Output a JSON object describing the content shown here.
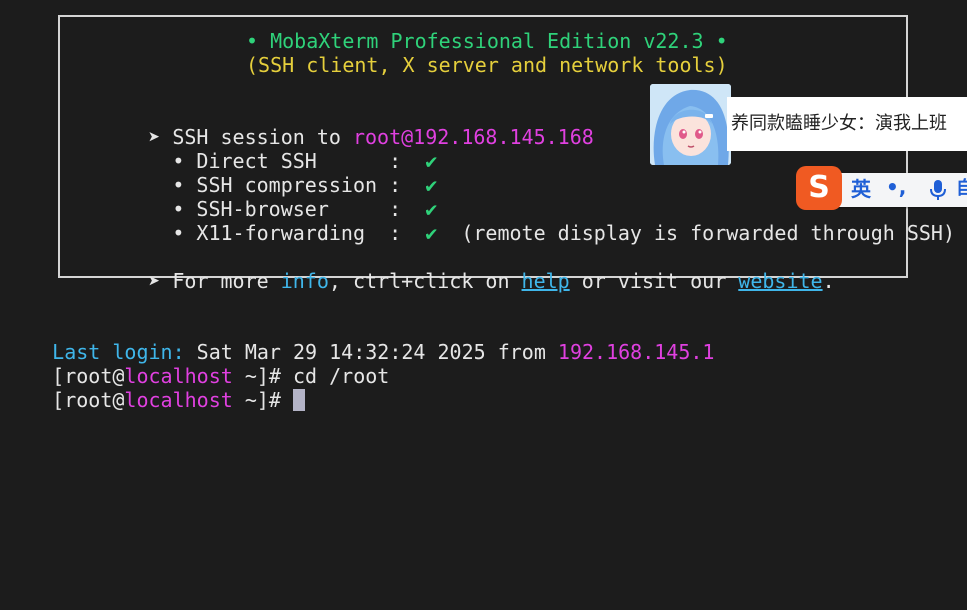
{
  "banner": {
    "title": "• MobaXterm Professional Edition v22.3 •",
    "subtitle": "(SSH client, X server and network tools)",
    "session_prefix": "➤ SSH session to ",
    "session_target": "root@192.168.145.168",
    "features": [
      {
        "label": "  • Direct SSH      :  ",
        "check": "✔",
        "note": ""
      },
      {
        "label": "  • SSH compression :  ",
        "check": "✔",
        "note": ""
      },
      {
        "label": "  • SSH-browser     :  ",
        "check": "✔",
        "note": ""
      },
      {
        "label": "  • X11-forwarding  :  ",
        "check": "✔",
        "note": "  (remote display is forwarded through SSH)"
      }
    ],
    "info_line": {
      "prefix": "➤ For more ",
      "info": "info",
      "middle1": ", ctrl+click on ",
      "help": "help",
      "middle2": " or visit our ",
      "website": "website",
      "suffix": "."
    }
  },
  "terminal": {
    "last_login_label": "Last login:",
    "last_login_value": " Sat Mar 29 14:32:24 2025 from ",
    "last_login_ip": "192.168.145.1",
    "prompt_open": "[root@",
    "prompt_host": "localhost",
    "prompt_close": " ~]# ",
    "command1": "cd /root",
    "command2": ""
  },
  "overlay": {
    "sticker_text": "养同款瞌睡少女：演我上班"
  },
  "ime": {
    "logo": "S",
    "lang": "英",
    "punct": "•,",
    "extra": "自"
  },
  "colors": {
    "background": "#1c1c1c",
    "green": "#2fd27a",
    "yellow": "#e5cf3c",
    "magenta": "#e040e0",
    "cyan": "#3fb6ea",
    "ime_orange": "#f05a22",
    "ime_blue": "#1f5fd6"
  },
  "icons": [
    "check-icon",
    "sogou-logo-icon",
    "microphone-icon",
    "arrow-bullet-icon"
  ]
}
